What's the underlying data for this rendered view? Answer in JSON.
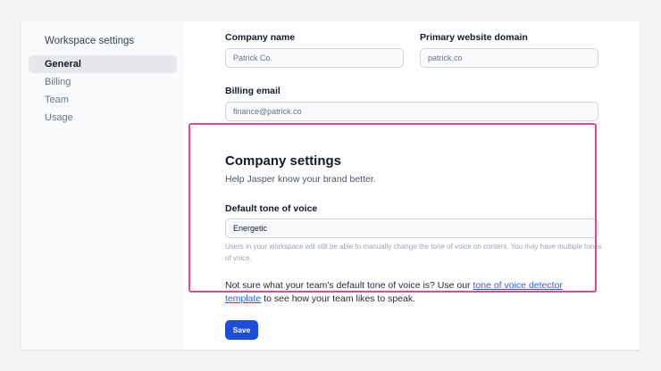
{
  "sidebar": {
    "title": "Workspace settings",
    "items": [
      {
        "label": "General",
        "active": true
      },
      {
        "label": "Billing",
        "active": false
      },
      {
        "label": "Team",
        "active": false
      },
      {
        "label": "Usage",
        "active": false
      }
    ]
  },
  "form": {
    "company_name_label": "Company name",
    "company_name_value": "Patrick Co.",
    "domain_label": "Primary website domain",
    "domain_value": "patrick.co",
    "billing_email_label": "Billing email",
    "billing_email_value": "finance@patrick.co"
  },
  "company_settings": {
    "title": "Company settings",
    "subtitle": "Help Jasper know your brand better.",
    "tone_label": "Default tone of voice",
    "tone_value": "Energetic",
    "tone_help": "Users in your workspace will still be able to manually change the tone of voice on content. You may have multiple tones of voice.",
    "note_before": "Not sure what your team's default tone of voice is? Use our ",
    "note_link": "tone of voice detector template",
    "note_after": " to see how your team likes to speak.",
    "highlight_color": "#e0479e"
  },
  "actions": {
    "save_label": "Save",
    "save_color": "#1d4ed8"
  }
}
